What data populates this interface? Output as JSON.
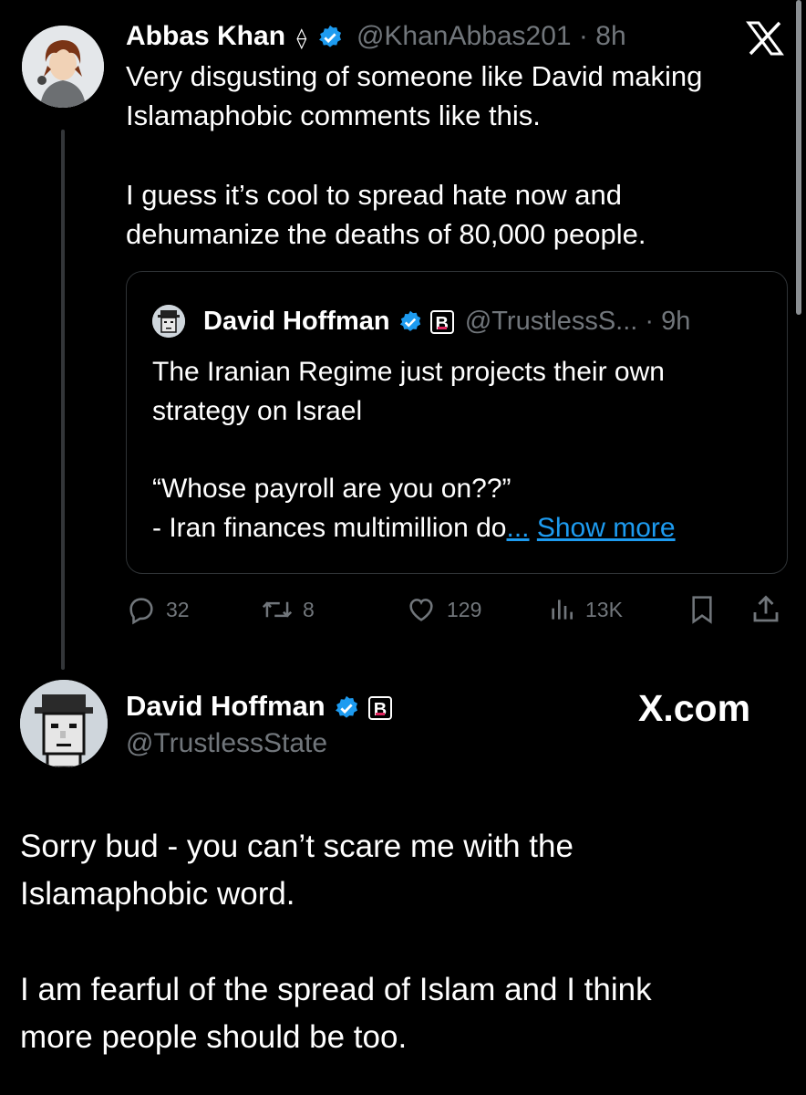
{
  "reply_tweet": {
    "author_name": "Abbas Khan",
    "eth_symbol": "⟠",
    "handle": "@KhanAbbas201",
    "separator": "·",
    "time": "8h",
    "text_p1": "Very disgusting of someone like David making Islamaphobic comments like this.",
    "text_p2": "I guess it’s cool to spread hate now and dehumanize the deaths of 80,000 people.",
    "quote": {
      "author_name": "David Hoffman",
      "badge": "B",
      "handle": "@TrustlessS...",
      "separator": "·",
      "time": "9h",
      "text_p1": "The Iranian Regime just projects their own strategy on Israel",
      "text_p2_line1": "“Whose payroll are you on??”",
      "text_p2_line2": "- Iran finances multimillion do",
      "ellipsis": "...",
      "show_more": "Show more"
    },
    "actions": {
      "replies": "32",
      "reposts": "8",
      "likes": "129",
      "views": "13K"
    }
  },
  "main_tweet": {
    "author_name": "David Hoffman",
    "badge": "B",
    "handle": "@TrustlessState",
    "site_label": "X.com",
    "text_p1": "Sorry bud - you can’t scare me with the Islamaphobic word.",
    "text_p2": "I am fearful of the spread of Islam and I think more people should be too."
  },
  "colors": {
    "background": "#000000",
    "text": "#ffffff",
    "muted": "#71767b",
    "verified": "#1d9bf0",
    "link": "#1d9bf0",
    "badge_accent": "#e0245e"
  }
}
